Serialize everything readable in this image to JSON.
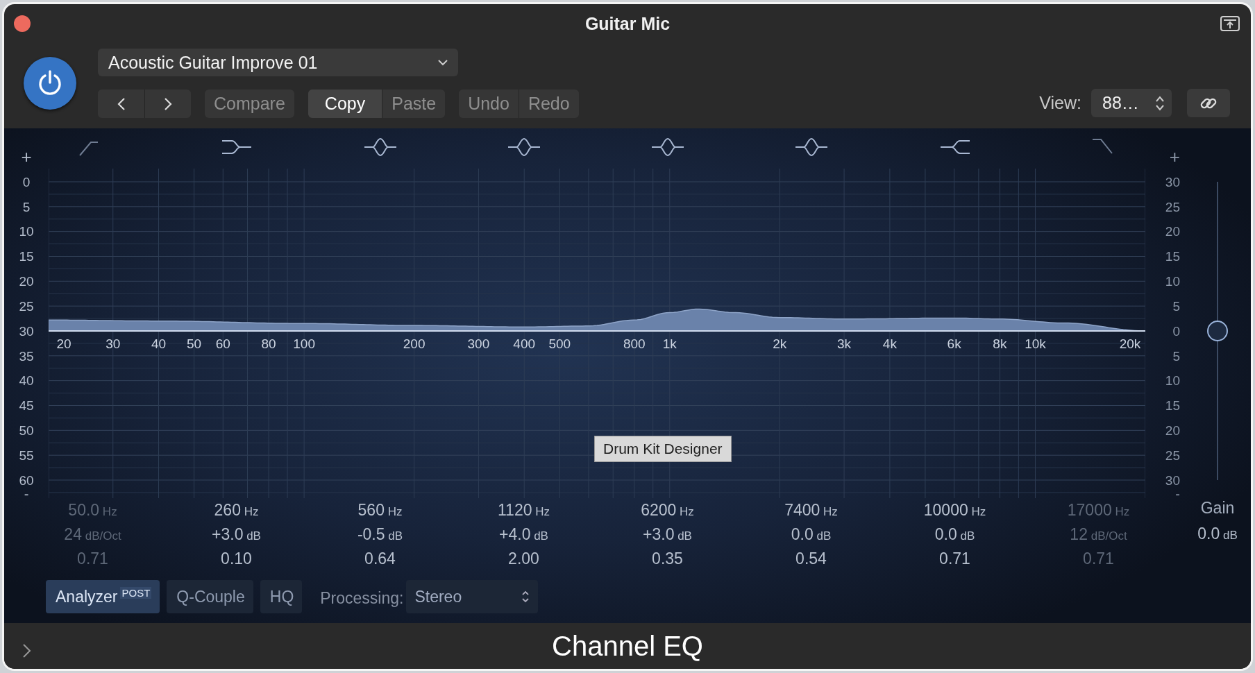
{
  "window": {
    "title": "Guitar Mic"
  },
  "toolbar": {
    "power": {
      "on": true
    },
    "preset": {
      "value": "Acoustic Guitar Improve 01"
    },
    "nav_buttons": [
      {
        "kind": "previous"
      },
      {
        "kind": "next"
      }
    ],
    "button_groups": [
      [
        {
          "label": "Compare",
          "disabled": true
        }
      ],
      [
        {
          "label": "Copy",
          "disabled": false
        },
        {
          "label": "Paste",
          "disabled": true
        }
      ],
      [
        {
          "label": "Undo",
          "disabled": true
        },
        {
          "label": "Redo",
          "disabled": true
        }
      ]
    ],
    "view": {
      "label": "View:",
      "value": "88…"
    }
  },
  "eq": {
    "left_scale": [
      "+",
      "0",
      "5",
      "10",
      "15",
      "20",
      "25",
      "30",
      "35",
      "40",
      "45",
      "50",
      "55",
      "60",
      "-"
    ],
    "right_scale": [
      "+",
      "30",
      "25",
      "20",
      "15",
      "10",
      "5",
      "0",
      "5",
      "10",
      "15",
      "20",
      "25",
      "30",
      "-"
    ],
    "frequency_labels": [
      "20",
      "30",
      "40",
      "50",
      "60",
      "80",
      "100",
      "200",
      "300",
      "400",
      "500",
      "800",
      "1k",
      "2k",
      "3k",
      "4k",
      "6k",
      "8k",
      "10k",
      "20k"
    ],
    "bands": [
      {
        "kind": "lowcut",
        "enabled": false,
        "frequency": "50.0",
        "frequency_unit": "Hz",
        "gain": "24",
        "gain_unit": "dB/Oct",
        "q": "0.71"
      },
      {
        "kind": "lowshelf",
        "enabled": true,
        "frequency": "260",
        "frequency_unit": "Hz",
        "gain": "+3.0",
        "gain_unit": "dB",
        "q": "0.10"
      },
      {
        "kind": "bell",
        "enabled": true,
        "frequency": "560",
        "frequency_unit": "Hz",
        "gain": "-0.5",
        "gain_unit": "dB",
        "q": "0.64"
      },
      {
        "kind": "bell",
        "enabled": true,
        "frequency": "1120",
        "frequency_unit": "Hz",
        "gain": "+4.0",
        "gain_unit": "dB",
        "q": "2.00"
      },
      {
        "kind": "bell",
        "enabled": true,
        "frequency": "6200",
        "frequency_unit": "Hz",
        "gain": "+3.0",
        "gain_unit": "dB",
        "q": "0.35"
      },
      {
        "kind": "bell",
        "enabled": true,
        "frequency": "7400",
        "frequency_unit": "Hz",
        "gain": "0.0",
        "gain_unit": "dB",
        "q": "0.54"
      },
      {
        "kind": "highshelf",
        "enabled": true,
        "frequency": "10000",
        "frequency_unit": "Hz",
        "gain": "0.0",
        "gain_unit": "dB",
        "q": "0.71"
      },
      {
        "kind": "highcut",
        "enabled": false,
        "frequency": "17000",
        "frequency_unit": "Hz",
        "gain": "12",
        "gain_unit": "dB/Oct",
        "q": "0.71"
      }
    ],
    "gain": {
      "label": "Gain",
      "value": "0.0",
      "unit": "dB",
      "level": 0.5
    },
    "tooltip": "Drum Kit Designer",
    "options": [
      {
        "label": "Analyzer",
        "badge": "POST",
        "on": true
      },
      {
        "label": "Q-Couple",
        "on": false
      },
      {
        "label": "HQ",
        "on": false
      }
    ],
    "processing": {
      "label": "Processing:",
      "value": "Stereo"
    }
  },
  "footer": {
    "title": "Channel EQ"
  }
}
